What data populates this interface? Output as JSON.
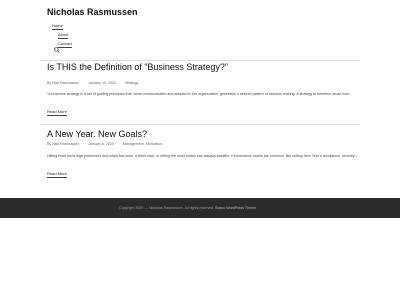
{
  "site": {
    "title": "Nicholas Rasmussen"
  },
  "nav": {
    "items": [
      {
        "label": "Home"
      },
      {
        "label": "About"
      },
      {
        "label": "Contact"
      }
    ],
    "search_icon": "search-icon"
  },
  "posts": [
    {
      "title": "Is THIS the Definition of “Business Strategy?”",
      "author": "By Nick Rasmussen",
      "date": "January 10, 2020",
      "category": "Strategy",
      "excerpt": "“A business strategy is a set of guiding principles that, when communicated and adopted in the organization, generates a desired pattern of decision making. A strategy is therefore about how…",
      "read_more": "Read More"
    },
    {
      "title": "A New Year. New Goals?",
      "author": "By Nick Rasmussen",
      "date": "January 6, 2020",
      "category": "Management, Motivation",
      "excerpt": "Hitting reset hurts high performers and helps low ones. A fresh start, or hitting the reset button can actually backfire. Performance resets are common, like setting New Year’s resolutions, recently…",
      "read_more": "Read More"
    }
  ],
  "footer": {
    "copyright": "Copyright 2020 — Nicholas Rasmussen. All rights reserved.",
    "theme_link": "Bosco WordPress Theme"
  },
  "colors": {
    "footer_bg": "#2a2d2f",
    "text": "#222222",
    "meta": "#666666"
  }
}
